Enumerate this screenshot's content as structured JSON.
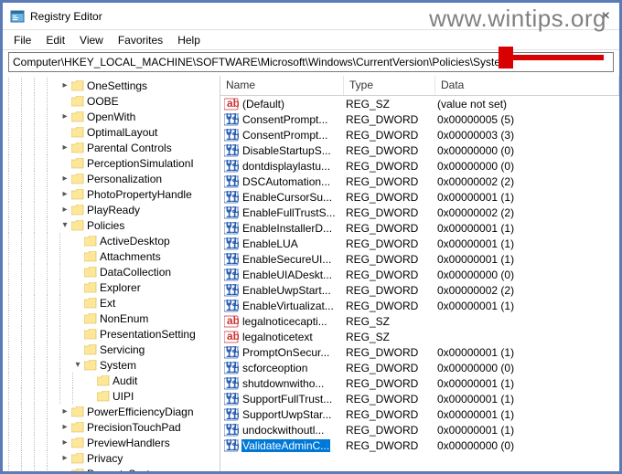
{
  "window": {
    "title": "Registry Editor",
    "address": "Computer\\HKEY_LOCAL_MACHINE\\SOFTWARE\\Microsoft\\Windows\\CurrentVersion\\Policies\\System"
  },
  "menu": {
    "file": "File",
    "edit": "Edit",
    "view": "View",
    "favorites": "Favorites",
    "help": "Help"
  },
  "columns": {
    "name": "Name",
    "type": "Type",
    "data": "Data"
  },
  "tree": [
    {
      "depth": 4,
      "toggle": ">",
      "label": "OneSettings"
    },
    {
      "depth": 4,
      "toggle": "",
      "label": "OOBE"
    },
    {
      "depth": 4,
      "toggle": ">",
      "label": "OpenWith"
    },
    {
      "depth": 4,
      "toggle": "",
      "label": "OptimalLayout"
    },
    {
      "depth": 4,
      "toggle": ">",
      "label": "Parental Controls"
    },
    {
      "depth": 4,
      "toggle": "",
      "label": "PerceptionSimulationI"
    },
    {
      "depth": 4,
      "toggle": ">",
      "label": "Personalization"
    },
    {
      "depth": 4,
      "toggle": ">",
      "label": "PhotoPropertyHandle"
    },
    {
      "depth": 4,
      "toggle": ">",
      "label": "PlayReady"
    },
    {
      "depth": 4,
      "toggle": "v",
      "label": "Policies"
    },
    {
      "depth": 5,
      "toggle": "",
      "label": "ActiveDesktop"
    },
    {
      "depth": 5,
      "toggle": "",
      "label": "Attachments"
    },
    {
      "depth": 5,
      "toggle": "",
      "label": "DataCollection"
    },
    {
      "depth": 5,
      "toggle": "",
      "label": "Explorer"
    },
    {
      "depth": 5,
      "toggle": "",
      "label": "Ext"
    },
    {
      "depth": 5,
      "toggle": "",
      "label": "NonEnum"
    },
    {
      "depth": 5,
      "toggle": "",
      "label": "PresentationSetting"
    },
    {
      "depth": 5,
      "toggle": "",
      "label": "Servicing"
    },
    {
      "depth": 5,
      "toggle": "v",
      "label": "System"
    },
    {
      "depth": 6,
      "toggle": "",
      "label": "Audit"
    },
    {
      "depth": 6,
      "toggle": "",
      "label": "UIPI"
    },
    {
      "depth": 4,
      "toggle": ">",
      "label": "PowerEfficiencyDiagn"
    },
    {
      "depth": 4,
      "toggle": ">",
      "label": "PrecisionTouchPad"
    },
    {
      "depth": 4,
      "toggle": ">",
      "label": "PreviewHandlers"
    },
    {
      "depth": 4,
      "toggle": ">",
      "label": "Privacy"
    },
    {
      "depth": 4,
      "toggle": ">",
      "label": "PropertySystem"
    }
  ],
  "values": [
    {
      "icon": "sz",
      "name": "(Default)",
      "type": "REG_SZ",
      "data": "(value not set)"
    },
    {
      "icon": "dw",
      "name": "ConsentPrompt...",
      "type": "REG_DWORD",
      "data": "0x00000005 (5)"
    },
    {
      "icon": "dw",
      "name": "ConsentPrompt...",
      "type": "REG_DWORD",
      "data": "0x00000003 (3)"
    },
    {
      "icon": "dw",
      "name": "DisableStartupS...",
      "type": "REG_DWORD",
      "data": "0x00000000 (0)"
    },
    {
      "icon": "dw",
      "name": "dontdisplaylastu...",
      "type": "REG_DWORD",
      "data": "0x00000000 (0)"
    },
    {
      "icon": "dw",
      "name": "DSCAutomation...",
      "type": "REG_DWORD",
      "data": "0x00000002 (2)"
    },
    {
      "icon": "dw",
      "name": "EnableCursorSu...",
      "type": "REG_DWORD",
      "data": "0x00000001 (1)"
    },
    {
      "icon": "dw",
      "name": "EnableFullTrustS...",
      "type": "REG_DWORD",
      "data": "0x00000002 (2)"
    },
    {
      "icon": "dw",
      "name": "EnableInstallerD...",
      "type": "REG_DWORD",
      "data": "0x00000001 (1)"
    },
    {
      "icon": "dw",
      "name": "EnableLUA",
      "type": "REG_DWORD",
      "data": "0x00000001 (1)"
    },
    {
      "icon": "dw",
      "name": "EnableSecureUI...",
      "type": "REG_DWORD",
      "data": "0x00000001 (1)"
    },
    {
      "icon": "dw",
      "name": "EnableUIADeskt...",
      "type": "REG_DWORD",
      "data": "0x00000000 (0)"
    },
    {
      "icon": "dw",
      "name": "EnableUwpStart...",
      "type": "REG_DWORD",
      "data": "0x00000002 (2)"
    },
    {
      "icon": "dw",
      "name": "EnableVirtualizat...",
      "type": "REG_DWORD",
      "data": "0x00000001 (1)"
    },
    {
      "icon": "sz",
      "name": "legalnoticecapti...",
      "type": "REG_SZ",
      "data": ""
    },
    {
      "icon": "sz",
      "name": "legalnoticetext",
      "type": "REG_SZ",
      "data": ""
    },
    {
      "icon": "dw",
      "name": "PromptOnSecur...",
      "type": "REG_DWORD",
      "data": "0x00000001 (1)"
    },
    {
      "icon": "dw",
      "name": "scforceoption",
      "type": "REG_DWORD",
      "data": "0x00000000 (0)"
    },
    {
      "icon": "dw",
      "name": "shutdownwitho...",
      "type": "REG_DWORD",
      "data": "0x00000001 (1)"
    },
    {
      "icon": "dw",
      "name": "SupportFullTrust...",
      "type": "REG_DWORD",
      "data": "0x00000001 (1)"
    },
    {
      "icon": "dw",
      "name": "SupportUwpStar...",
      "type": "REG_DWORD",
      "data": "0x00000001 (1)"
    },
    {
      "icon": "dw",
      "name": "undockwithoutl...",
      "type": "REG_DWORD",
      "data": "0x00000001 (1)"
    },
    {
      "icon": "dw",
      "name": "ValidateAdminC...",
      "type": "REG_DWORD",
      "data": "0x00000000 (0)",
      "selected": true
    }
  ],
  "watermark": "www.wintips.org"
}
